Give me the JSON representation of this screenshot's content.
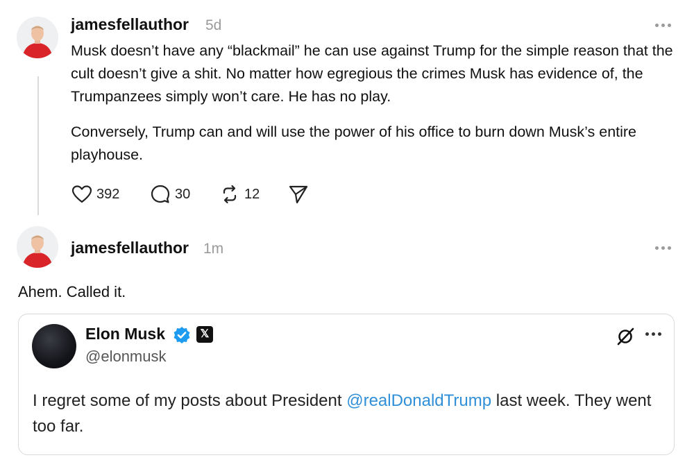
{
  "original_post": {
    "username": "jamesfellauthor",
    "timestamp": "5d",
    "paragraph_1": "Musk doesn’t have any “blackmail” he can use against Trump for the simple reason that the cult doesn’t give a shit. No matter how egregious the crimes Musk has evidence of, the Trumpanzees simply won’t care. He has no play.",
    "paragraph_2": "Conversely, Trump can and will use the power of his office to burn down Musk’s entire playhouse.",
    "actions": {
      "likes": "392",
      "replies": "30",
      "reposts": "12"
    }
  },
  "reply_post": {
    "username": "jamesfellauthor",
    "timestamp": "1m",
    "text": "Ahem. Called it."
  },
  "quoted_post": {
    "name": "Elon Musk",
    "handle": "@elonmusk",
    "badge_letter": "𝕏",
    "text_before": "I regret some of my posts about President ",
    "mention": "@realDonaldTrump",
    "text_after": " last week. They went too far."
  },
  "colors": {
    "mention": "#2f8fd8",
    "verified": "#1d9bf0",
    "timestamp": "#9a9a9a",
    "avatar_shirt": "#d9252a"
  },
  "icons": [
    "heart-icon",
    "reply-icon",
    "repost-icon",
    "share-icon",
    "more-icon",
    "verified-icon",
    "x-badge-icon",
    "grok-icon"
  ]
}
